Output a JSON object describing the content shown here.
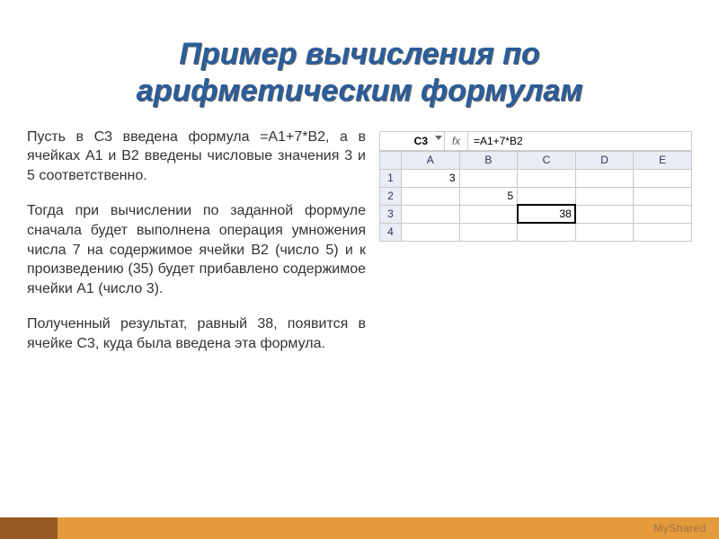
{
  "title": {
    "line1": "Пример вычисления по",
    "line2": "арифметическим формулам"
  },
  "paragraphs": {
    "p1": "Пусть в C3 введена формула =А1+7*В2, а в ячейках А1 и В2 введены числовые значения 3 и 5 соответственно.",
    "p2": "Тогда при вычислении по заданной формуле сначала будет выполнена операция умножения числа 7 на содержимое ячейки В2 (число 5) и к произведению (35) будет прибавлено содержимое ячейки А1 (число 3).",
    "p3": "Полученный результат, равный 38, появится в ячейке С3, куда была введена эта формула."
  },
  "spreadsheet": {
    "namebox": "C3",
    "fx_label": "fx",
    "formula": "=A1+7*B2",
    "columns": {
      "A": "A",
      "B": "B",
      "C": "C",
      "D": "D",
      "E": "E"
    },
    "rows": {
      "r1": "1",
      "r2": "2",
      "r3": "3",
      "r4": "4"
    },
    "cells": {
      "A1": "3",
      "B2": "5",
      "C3": "38"
    }
  },
  "watermark": "MyShared"
}
